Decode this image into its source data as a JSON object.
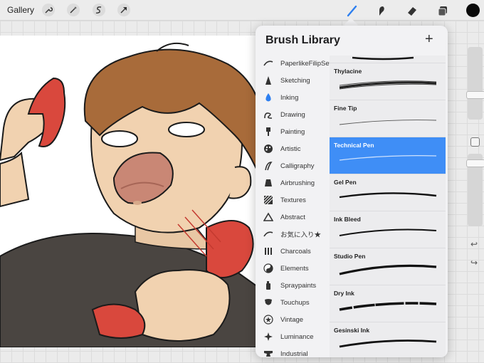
{
  "topbar": {
    "gallery_label": "Gallery",
    "left_tools": [
      "wrench-icon",
      "magic-wand-icon",
      "selection-icon",
      "transform-arrow-icon"
    ],
    "right_tools": [
      "brush-icon",
      "smudge-icon",
      "eraser-icon",
      "layers-icon"
    ],
    "active_tool": "brush-icon",
    "current_color": "#0a0a0a"
  },
  "library": {
    "title": "Brush Library",
    "add_symbol": "+",
    "categories": [
      {
        "label": "PaperlikeFilipSet",
        "icon": "swoosh-icon"
      },
      {
        "label": "Sketching",
        "icon": "pencil-tip-icon"
      },
      {
        "label": "Inking",
        "icon": "ink-drop-icon"
      },
      {
        "label": "Drawing",
        "icon": "squiggle-icon"
      },
      {
        "label": "Painting",
        "icon": "paint-brush-icon"
      },
      {
        "label": "Artistic",
        "icon": "palette-icon"
      },
      {
        "label": "Calligraphy",
        "icon": "calligraphy-icon"
      },
      {
        "label": "Airbrushing",
        "icon": "airbrush-icon"
      },
      {
        "label": "Textures",
        "icon": "texture-icon"
      },
      {
        "label": "Abstract",
        "icon": "triangle-icon"
      },
      {
        "label": "お気に入り★",
        "icon": "swoosh-icon"
      },
      {
        "label": "Charcoals",
        "icon": "charcoal-icon"
      },
      {
        "label": "Elements",
        "icon": "yin-yang-icon"
      },
      {
        "label": "Spraypaints",
        "icon": "spray-can-icon"
      },
      {
        "label": "Touchups",
        "icon": "touchup-icon"
      },
      {
        "label": "Vintage",
        "icon": "star-badge-icon"
      },
      {
        "label": "Luminance",
        "icon": "sparkle-icon"
      },
      {
        "label": "Industrial",
        "icon": "anvil-icon"
      }
    ],
    "active_category": "Inking",
    "brushes": [
      {
        "name": "Thylacine"
      },
      {
        "name": "Fine Tip"
      },
      {
        "name": "Technical Pen"
      },
      {
        "name": "Gel Pen"
      },
      {
        "name": "Ink Bleed"
      },
      {
        "name": "Studio Pen"
      },
      {
        "name": "Dry Ink"
      },
      {
        "name": "Gesinski Ink"
      }
    ],
    "selected_brush": "Technical Pen",
    "accent_color": "#3f8ef6"
  },
  "sidebar": {
    "brush_size_level": 0.7,
    "opacity_level": 0.25,
    "undo_symbol": "↩",
    "redo_symbol": "↪"
  }
}
